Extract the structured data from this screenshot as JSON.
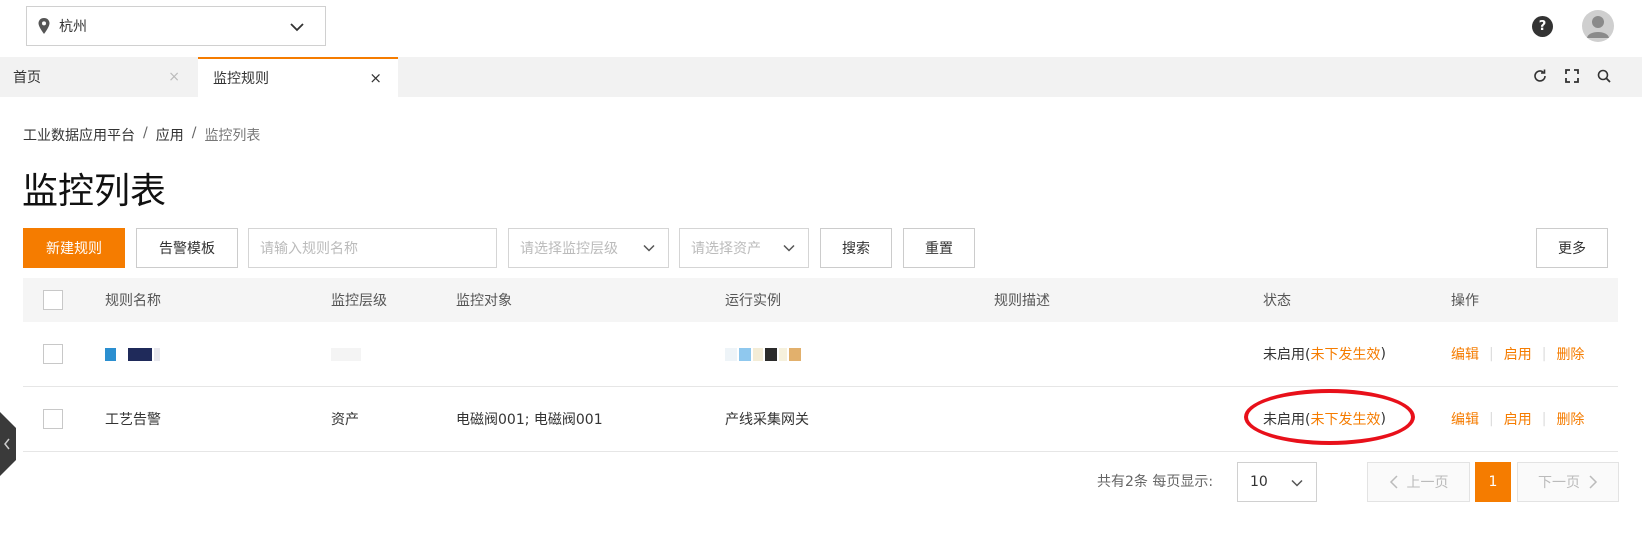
{
  "header": {
    "city": "杭州",
    "help_icon": "?"
  },
  "tabs": [
    {
      "label": "首页",
      "close": "×"
    },
    {
      "label": "监控规则",
      "close": "×"
    }
  ],
  "breadcrumb": {
    "items": [
      "工业数据应用平台",
      "应用",
      "监控列表"
    ],
    "separator": "/"
  },
  "page_title": "监控列表",
  "toolbar": {
    "new_rule": "新建规则",
    "alarm_template": "告警模板",
    "rule_name_placeholder": "请输入规则名称",
    "monitor_level_placeholder": "请选择监控层级",
    "asset_placeholder": "请选择资产",
    "search": "搜索",
    "reset": "重置",
    "more": "更多"
  },
  "table": {
    "columns": [
      "规则名称",
      "监控层级",
      "监控对象",
      "运行实例",
      "规则描述",
      "状态",
      "操作"
    ],
    "rows": [
      {
        "name": "",
        "level": "",
        "object": "",
        "instance": "",
        "description": "",
        "status_main": "未启用(",
        "status_sub": "未下发生效",
        "status_close": ")",
        "actions": [
          "编辑",
          "启用",
          "删除"
        ]
      },
      {
        "name": "工艺告警",
        "level": "资产",
        "object": "电磁阀001; 电磁阀001",
        "instance": "产线采集网关",
        "description": "",
        "status_main": "未启用(",
        "status_sub": "未下发生效",
        "status_close": ")",
        "actions": [
          "编辑",
          "启用",
          "删除"
        ]
      }
    ]
  },
  "pagination": {
    "total_text": "共有2条 每页显示:",
    "page_size": "10",
    "prev": "上一页",
    "current": "1",
    "next": "下一页"
  },
  "colors": {
    "accent": "#f57c00",
    "highlight": "#e8101a"
  }
}
